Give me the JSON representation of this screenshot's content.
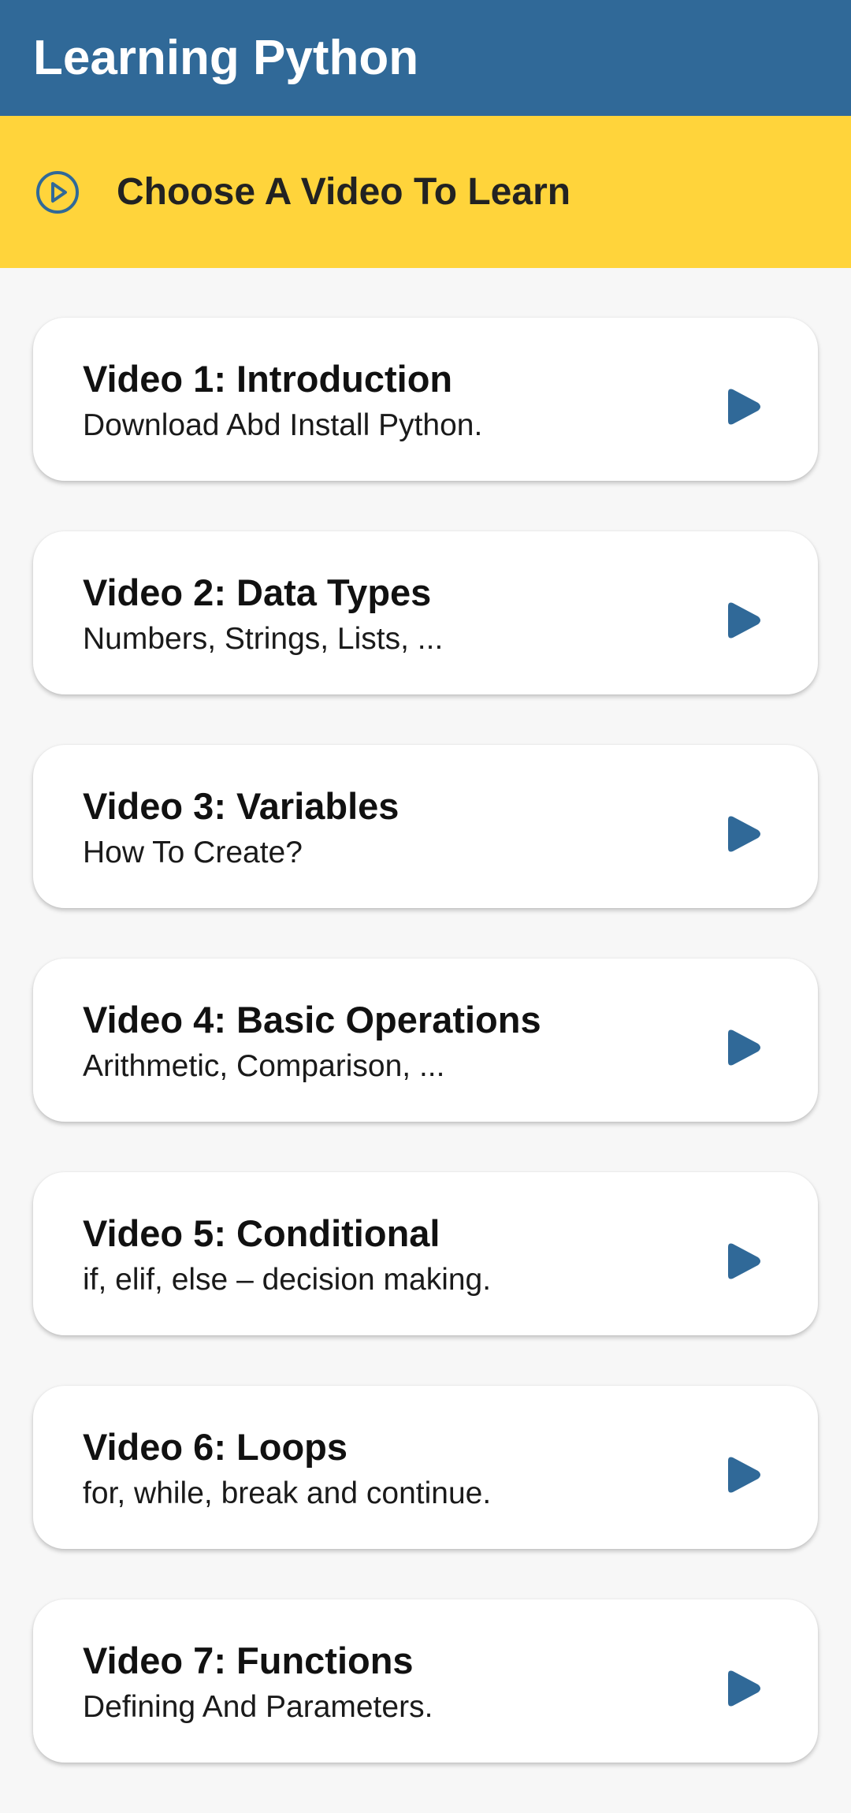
{
  "app_bar": {
    "title": "Learning Python",
    "color": "#306998"
  },
  "banner": {
    "icon": "play-circle-outline-icon",
    "text": "Choose A Video To Learn",
    "color": "#ffd43b"
  },
  "videos": [
    {
      "title": "Video 1: Introduction",
      "subtitle": "Download Abd Install Python.",
      "icon": "play-icon"
    },
    {
      "title": "Video 2: Data Types",
      "subtitle": "Numbers, Strings, Lists, ...",
      "icon": "play-icon"
    },
    {
      "title": "Video 3: Variables",
      "subtitle": "How To Create?",
      "icon": "play-icon"
    },
    {
      "title": "Video 4: Basic Operations",
      "subtitle": "Arithmetic, Comparison, ...",
      "icon": "play-icon"
    },
    {
      "title": "Video 5: Conditional",
      "subtitle": "if, elif, else – decision making.",
      "icon": "play-icon"
    },
    {
      "title": "Video 6: Loops",
      "subtitle": "for, while, break and continue.",
      "icon": "play-icon"
    },
    {
      "title": "Video 7: Functions",
      "subtitle": "Defining And Parameters.",
      "icon": "play-icon"
    }
  ]
}
